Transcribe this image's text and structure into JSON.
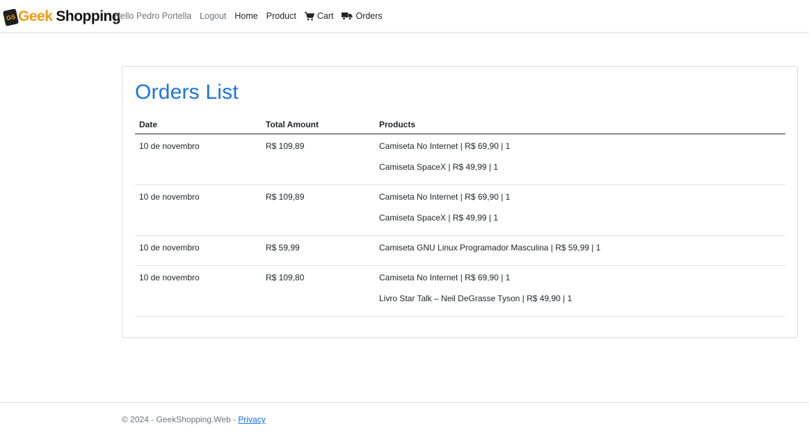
{
  "brand": {
    "badge": "GS",
    "geek": "Geek",
    "shopping": "Shopping"
  },
  "nav": {
    "greeting": "Hello Pedro Portella",
    "logout": "Logout",
    "home": "Home",
    "product": "Product",
    "cart": "Cart",
    "orders": "Orders"
  },
  "page_title": "Orders List",
  "table": {
    "headers": {
      "date": "Date",
      "total": "Total Amount",
      "products": "Products"
    },
    "rows": [
      {
        "date": "10 de novembro",
        "total": "R$ 109,89",
        "products": [
          "Camiseta No Internet | R$ 69,90 | 1",
          "Camiseta SpaceX | R$ 49,99 | 1"
        ]
      },
      {
        "date": "10 de novembro",
        "total": "R$ 109,89",
        "products": [
          "Camiseta No Internet | R$ 69,90 | 1",
          "Camiseta SpaceX | R$ 49,99 | 1"
        ]
      },
      {
        "date": "10 de novembro",
        "total": "R$ 59,99",
        "products": [
          "Camiseta GNU Linux Programador Masculina | R$ 59,99 | 1"
        ]
      },
      {
        "date": "10 de novembro",
        "total": "R$ 109,80",
        "products": [
          "Camiseta No Internet | R$ 69,90 | 1",
          "Livro Star Talk – Neil DeGrasse Tyson | R$ 49,90 | 1"
        ]
      }
    ]
  },
  "footer": {
    "text": "© 2024 - GeekShopping.Web - ",
    "privacy": "Privacy"
  },
  "colors": {
    "accent": "#1a73e8",
    "brand_orange": "#f39a12"
  }
}
